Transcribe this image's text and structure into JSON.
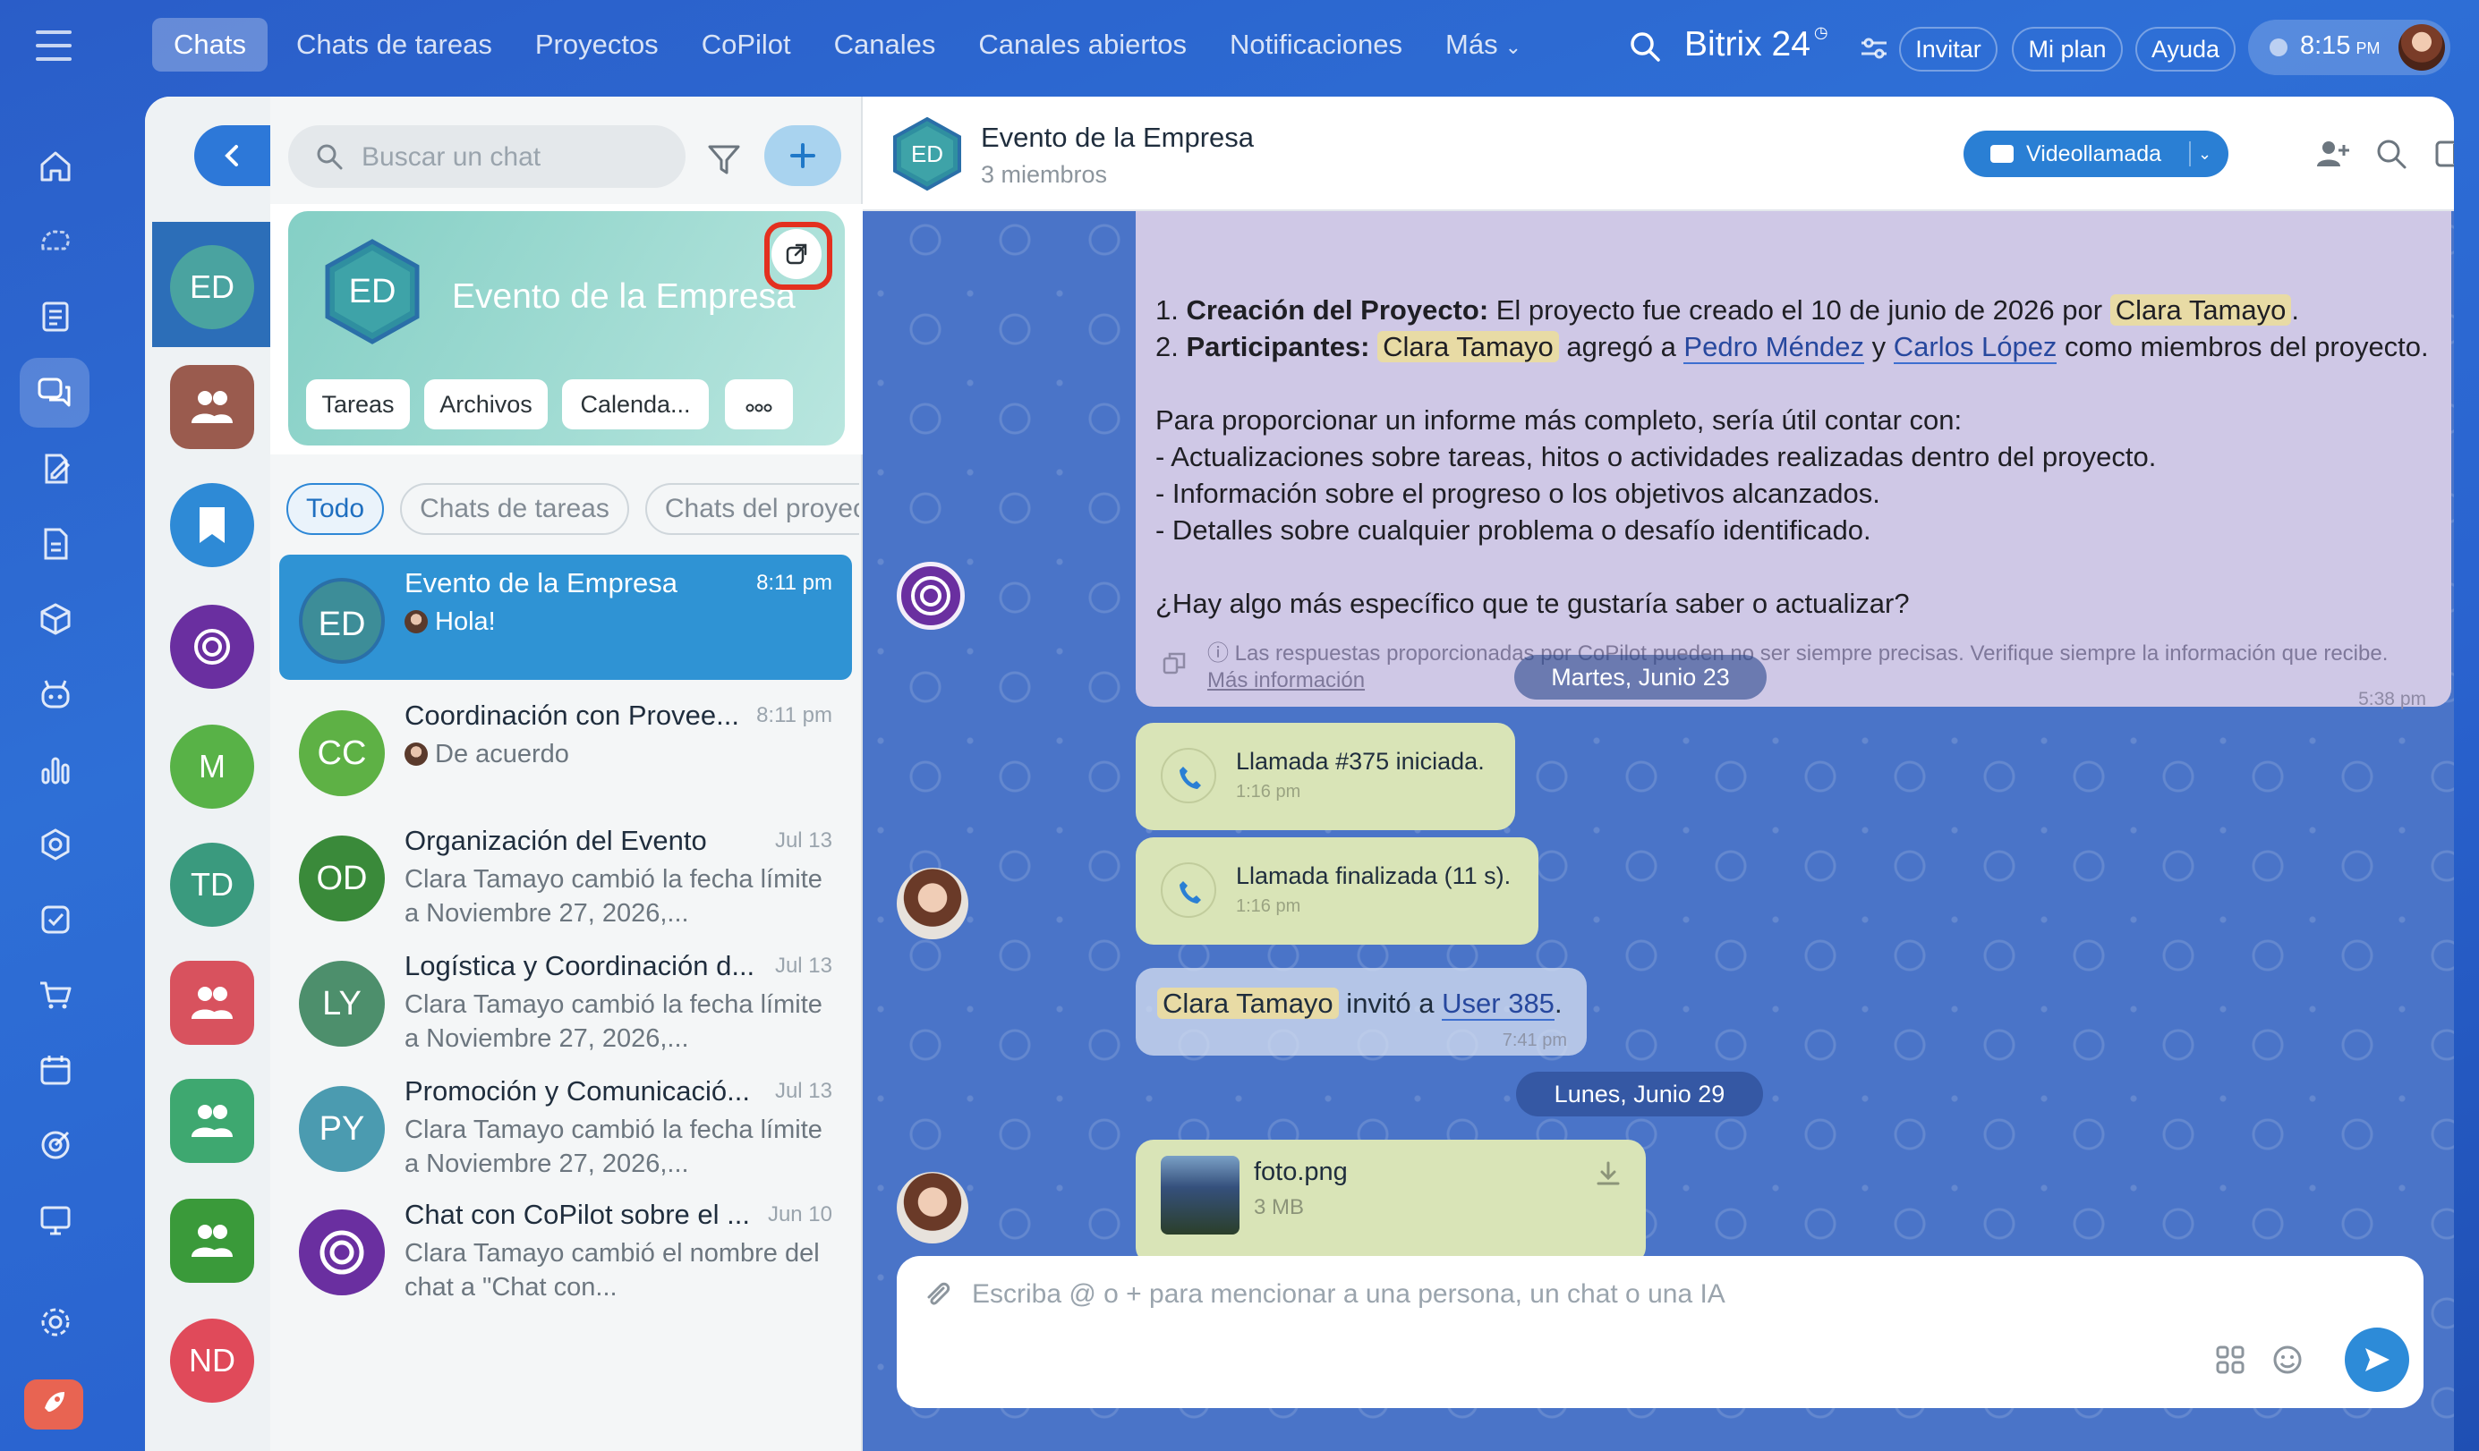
{
  "topbar": {
    "tabs": [
      "Chats",
      "Chats de tareas",
      "Proyectos",
      "CoPilot",
      "Canales",
      "Canales abiertos",
      "Notificaciones",
      "Más"
    ],
    "brand": "Bitrix 24",
    "invite": "Invitar",
    "plan": "Mi plan",
    "help": "Ayuda",
    "time": "8:15",
    "ampm": "PM"
  },
  "recent": {
    "items": [
      {
        "initials": "ED",
        "color": "#4aa3a0"
      },
      {
        "initials": "",
        "color": "#9a5b4e"
      },
      {
        "initials": "",
        "color": "#2e8ad6"
      },
      {
        "initials": "",
        "color": "#6a2fa0"
      },
      {
        "initials": "M",
        "color": "#58b247"
      },
      {
        "initials": "TD",
        "color": "#3a9a7e"
      },
      {
        "initials": "",
        "color": "#d8525e"
      },
      {
        "initials": "",
        "color": "#3ea870"
      },
      {
        "initials": "",
        "color": "#3a9a3a"
      },
      {
        "initials": "ND",
        "color": "#e04a5a"
      }
    ]
  },
  "sidebar": {
    "search_placeholder": "Buscar un chat",
    "card": {
      "initials": "ED",
      "title": "Evento de la Empresa",
      "buttons": [
        "Tareas",
        "Archivos",
        "Calenda..."
      ]
    },
    "chips": [
      "Todo",
      "Chats de tareas",
      "Chats del proyecto"
    ],
    "chats": [
      {
        "initials": "ED",
        "color": "#3d8d98",
        "name": "Evento de la Empresa",
        "time": "8:11 pm",
        "message": "Hola!"
      },
      {
        "initials": "CC",
        "color": "#5eb145",
        "name": "Coordinación con Provee...",
        "time": "8:11 pm",
        "message": "De acuerdo"
      },
      {
        "initials": "OD",
        "color": "#3a8a3a",
        "name": "Organización del Evento",
        "time": "Jul 13",
        "message": "Clara Tamayo cambió la fecha límite a Noviembre 27, 2026,..."
      },
      {
        "initials": "LY",
        "color": "#4d8f6c",
        "name": "Logística y Coordinación d...",
        "time": "Jul 13",
        "message": "Clara Tamayo cambió la fecha límite a Noviembre 27, 2026,..."
      },
      {
        "initials": "PY",
        "color": "#4b9bb0",
        "name": "Promoción y Comunicació...",
        "time": "Jul 13",
        "message": "Clara Tamayo cambió la fecha límite a Noviembre 27, 2026,..."
      },
      {
        "initials": "",
        "color": "#6a2fa0",
        "name": "Chat con CoPilot sobre el ...",
        "time": "Jun 10",
        "message": "Clara Tamayo cambió el nombre del chat a \"Chat con..."
      }
    ]
  },
  "chat": {
    "title": "Evento de la Empresa",
    "members": "3 miembros",
    "video_call": "Videollamada",
    "ai_message": {
      "line1_num": "1.",
      "line1_bold": "Creación del Proyecto:",
      "line1_text": " El proyecto fue creado el 10 de junio de 2026 por ",
      "line1_name": "Clara Tamayo",
      "line1_end": ".",
      "line2_num": "2.",
      "line2_bold": "Participantes:",
      "line2_name": "Clara Tamayo",
      "line2_mid": " agregó a ",
      "line2_m1": "Pedro Méndez",
      "line2_and": " y ",
      "line2_m2": "Carlos López",
      "line2_end": " como miembros del proyecto.",
      "para": "Para proporcionar un informe más completo, sería útil contar con:",
      "bullets": [
        "- Actualizaciones sobre tareas, hitos o actividades realizadas dentro del proyecto.",
        "- Información sobre el progreso o los objetivos alcanzados.",
        "- Detalles sobre cualquier problema o desafío identificado."
      ],
      "question": "¿Hay algo más específico que te gustaría saber o actualizar?",
      "disclaimer": "Las respuestas proporcionadas por CoPilot pueden no ser siempre precisas. Verifique siempre la información que recibe.",
      "more": "Más información",
      "time": "5:38 pm"
    },
    "date1": "Martes, Junio 23",
    "call_start": "Llamada #375 iniciada.",
    "call_start_time": "1:16 pm",
    "call_end": "Llamada finalizada (11 s).",
    "call_end_time": "1:16 pm",
    "invite_name": "Clara Tamayo",
    "invite_text": " invitó a ",
    "invite_user": "User 385",
    "invite_end": ".",
    "invite_time": "7:41 pm",
    "date2": "Lunes, Junio 29",
    "file_name": "foto.png",
    "file_size": "3 MB",
    "composer_placeholder": "Escriba @ o + para mencionar a una persona, un chat o una IA"
  }
}
